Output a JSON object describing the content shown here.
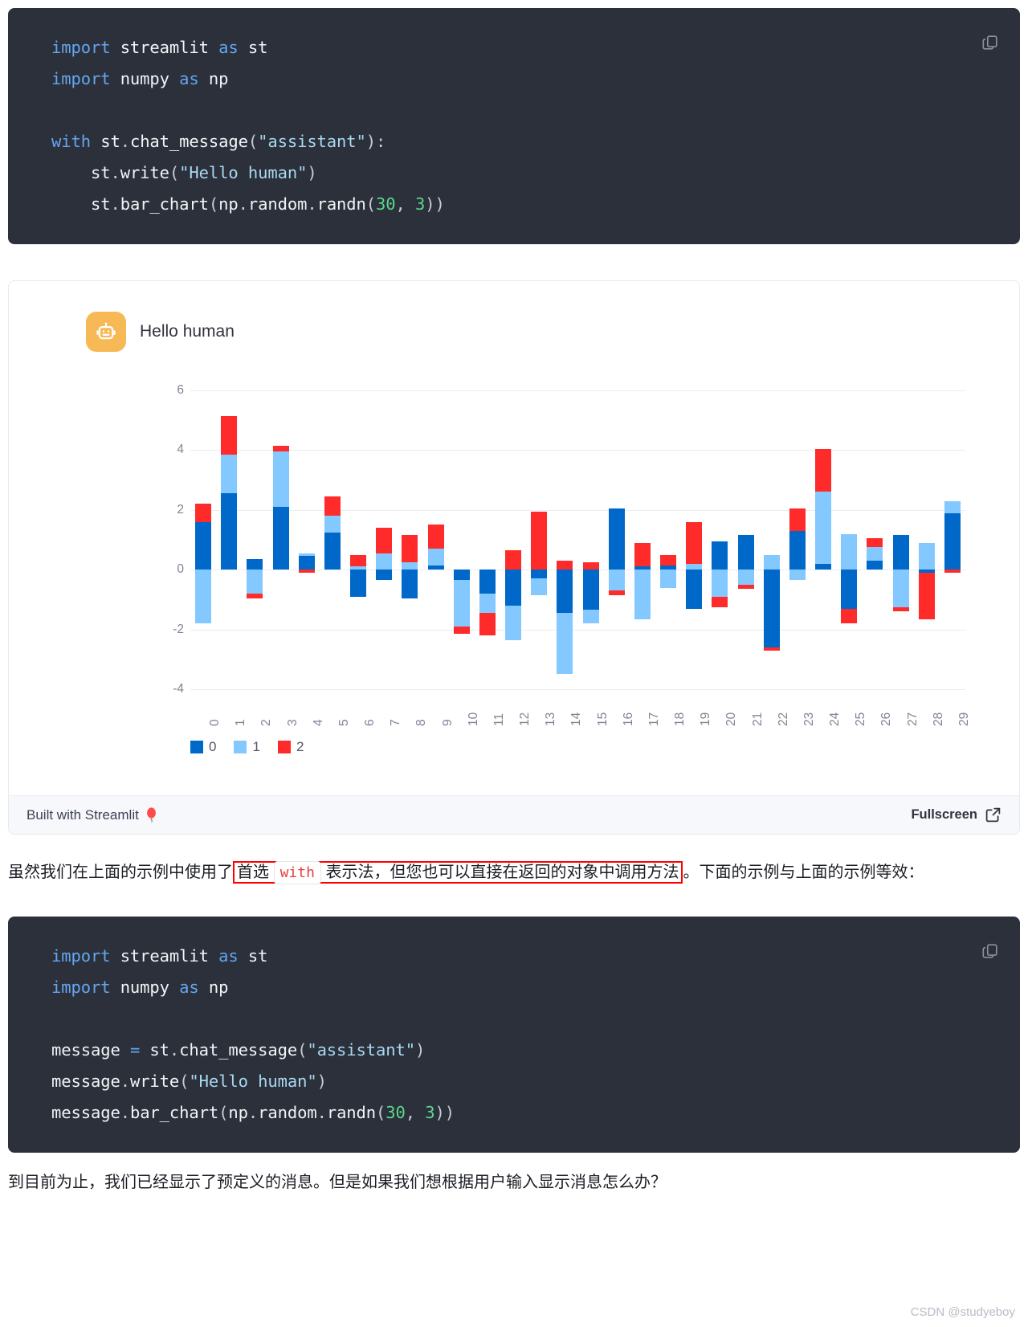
{
  "code_block_1": {
    "copy_icon": "copy-icon",
    "lines": [
      [
        {
          "t": "import",
          "c": "kw"
        },
        {
          "t": " streamlit ",
          "c": "plain"
        },
        {
          "t": "as",
          "c": "kw"
        },
        {
          "t": " st",
          "c": "plain"
        }
      ],
      [
        {
          "t": "import",
          "c": "kw"
        },
        {
          "t": " numpy ",
          "c": "plain"
        },
        {
          "t": "as",
          "c": "kw"
        },
        {
          "t": " np",
          "c": "plain"
        }
      ],
      [],
      [
        {
          "t": "with",
          "c": "kw"
        },
        {
          "t": " st",
          "c": "plain"
        },
        {
          "t": ".",
          "c": "punc"
        },
        {
          "t": "chat_message",
          "c": "plain"
        },
        {
          "t": "(",
          "c": "punc"
        },
        {
          "t": "\"assistant\"",
          "c": "str"
        },
        {
          "t": "):",
          "c": "punc"
        }
      ],
      [
        {
          "t": "    st",
          "c": "plain"
        },
        {
          "t": ".",
          "c": "punc"
        },
        {
          "t": "write",
          "c": "plain"
        },
        {
          "t": "(",
          "c": "punc"
        },
        {
          "t": "\"Hello human\"",
          "c": "str"
        },
        {
          "t": ")",
          "c": "punc"
        }
      ],
      [
        {
          "t": "    st",
          "c": "plain"
        },
        {
          "t": ".",
          "c": "punc"
        },
        {
          "t": "bar_chart",
          "c": "plain"
        },
        {
          "t": "(",
          "c": "punc"
        },
        {
          "t": "np",
          "c": "plain"
        },
        {
          "t": ".",
          "c": "punc"
        },
        {
          "t": "random",
          "c": "plain"
        },
        {
          "t": ".",
          "c": "punc"
        },
        {
          "t": "randn",
          "c": "plain"
        },
        {
          "t": "(",
          "c": "punc"
        },
        {
          "t": "30",
          "c": "num"
        },
        {
          "t": ", ",
          "c": "punc"
        },
        {
          "t": "3",
          "c": "num"
        },
        {
          "t": "))",
          "c": "punc"
        }
      ]
    ]
  },
  "app": {
    "avatar_icon": "robot-icon",
    "message_text": "Hello human",
    "footer": {
      "built_with": "Built with Streamlit",
      "balloon_icon": "balloon-icon",
      "fullscreen_label": "Fullscreen",
      "fullscreen_icon": "fullscreen-icon"
    }
  },
  "chart_data": {
    "type": "bar",
    "title": "",
    "xlabel": "",
    "ylabel": "",
    "ylim": [
      -4,
      6
    ],
    "yticks": [
      6,
      4,
      2,
      0,
      -2,
      -4
    ],
    "grid": true,
    "stacked": true,
    "legend_position": "bottom",
    "colors": {
      "0": "#0068c9",
      "1": "#83c9ff",
      "2": "#ff2b2b"
    },
    "categories": [
      "0",
      "1",
      "2",
      "3",
      "4",
      "5",
      "6",
      "7",
      "8",
      "9",
      "10",
      "11",
      "12",
      "13",
      "14",
      "15",
      "16",
      "17",
      "18",
      "19",
      "20",
      "21",
      "22",
      "23",
      "24",
      "25",
      "26",
      "27",
      "28",
      "29"
    ],
    "series": [
      {
        "name": "0",
        "values": [
          1.6,
          2.55,
          0.35,
          2.1,
          0.45,
          1.25,
          -0.9,
          -0.35,
          -0.95,
          0.15,
          -0.35,
          -0.8,
          -1.2,
          -0.3,
          -1.45,
          -1.35,
          2.05,
          0.1,
          0.15,
          -1.3,
          0.95,
          1.15,
          -2.6,
          1.3,
          0.2,
          -1.3,
          0.3,
          1.15,
          -0.1,
          1.9
        ]
      },
      {
        "name": "1",
        "values": [
          -1.8,
          1.3,
          -0.8,
          1.85,
          0.1,
          0.55,
          0.1,
          0.55,
          0.25,
          0.55,
          -1.55,
          -0.65,
          -1.15,
          -0.55,
          -2.05,
          -0.45,
          -0.7,
          -1.65,
          -0.6,
          0.2,
          -0.9,
          -0.5,
          0.5,
          -0.35,
          2.4,
          1.2,
          0.45,
          -1.25,
          0.9,
          0.4
        ]
      },
      {
        "name": "2",
        "values": [
          0.6,
          1.3,
          -0.15,
          0.2,
          -0.1,
          0.65,
          0.4,
          0.85,
          0.9,
          0.8,
          -0.25,
          -0.75,
          0.65,
          1.95,
          0.3,
          0.25,
          -0.15,
          0.8,
          0.35,
          1.4,
          -0.35,
          -0.15,
          -0.1,
          0.75,
          1.45,
          -0.5,
          0.3,
          -0.15,
          -1.55,
          -0.1
        ]
      }
    ],
    "legend": [
      "0",
      "1",
      "2"
    ]
  },
  "prose": {
    "before_box": "虽然我们在上面的示例中使用了",
    "box_part1": "首选",
    "box_code": "with",
    "box_part2": "表示法，但您也可以直接在返回的对象中调用方法",
    "after_box": "。下面的示例与上面的示例等效：",
    "annotation_color": "#ff0000"
  },
  "code_block_2": {
    "copy_icon": "copy-icon",
    "lines": [
      [
        {
          "t": "import",
          "c": "kw"
        },
        {
          "t": " streamlit ",
          "c": "plain"
        },
        {
          "t": "as",
          "c": "kw"
        },
        {
          "t": " st",
          "c": "plain"
        }
      ],
      [
        {
          "t": "import",
          "c": "kw"
        },
        {
          "t": " numpy ",
          "c": "plain"
        },
        {
          "t": "as",
          "c": "kw"
        },
        {
          "t": " np",
          "c": "plain"
        }
      ],
      [],
      [
        {
          "t": "message ",
          "c": "plain"
        },
        {
          "t": "=",
          "c": "kw"
        },
        {
          "t": " st",
          "c": "plain"
        },
        {
          "t": ".",
          "c": "punc"
        },
        {
          "t": "chat_message",
          "c": "plain"
        },
        {
          "t": "(",
          "c": "punc"
        },
        {
          "t": "\"assistant\"",
          "c": "str"
        },
        {
          "t": ")",
          "c": "punc"
        }
      ],
      [
        {
          "t": "message",
          "c": "plain"
        },
        {
          "t": ".",
          "c": "punc"
        },
        {
          "t": "write",
          "c": "plain"
        },
        {
          "t": "(",
          "c": "punc"
        },
        {
          "t": "\"Hello human\"",
          "c": "str"
        },
        {
          "t": ")",
          "c": "punc"
        }
      ],
      [
        {
          "t": "message",
          "c": "plain"
        },
        {
          "t": ".",
          "c": "punc"
        },
        {
          "t": "bar_chart",
          "c": "plain"
        },
        {
          "t": "(",
          "c": "punc"
        },
        {
          "t": "np",
          "c": "plain"
        },
        {
          "t": ".",
          "c": "punc"
        },
        {
          "t": "random",
          "c": "plain"
        },
        {
          "t": ".",
          "c": "punc"
        },
        {
          "t": "randn",
          "c": "plain"
        },
        {
          "t": "(",
          "c": "punc"
        },
        {
          "t": "30",
          "c": "num"
        },
        {
          "t": ", ",
          "c": "punc"
        },
        {
          "t": "3",
          "c": "num"
        },
        {
          "t": "))",
          "c": "punc"
        }
      ]
    ]
  },
  "tail_text": "到目前为止，我们已经显示了预定义的消息。但是如果我们想根据用户输入显示消息怎么办？",
  "watermark": "CSDN @studyeboy"
}
